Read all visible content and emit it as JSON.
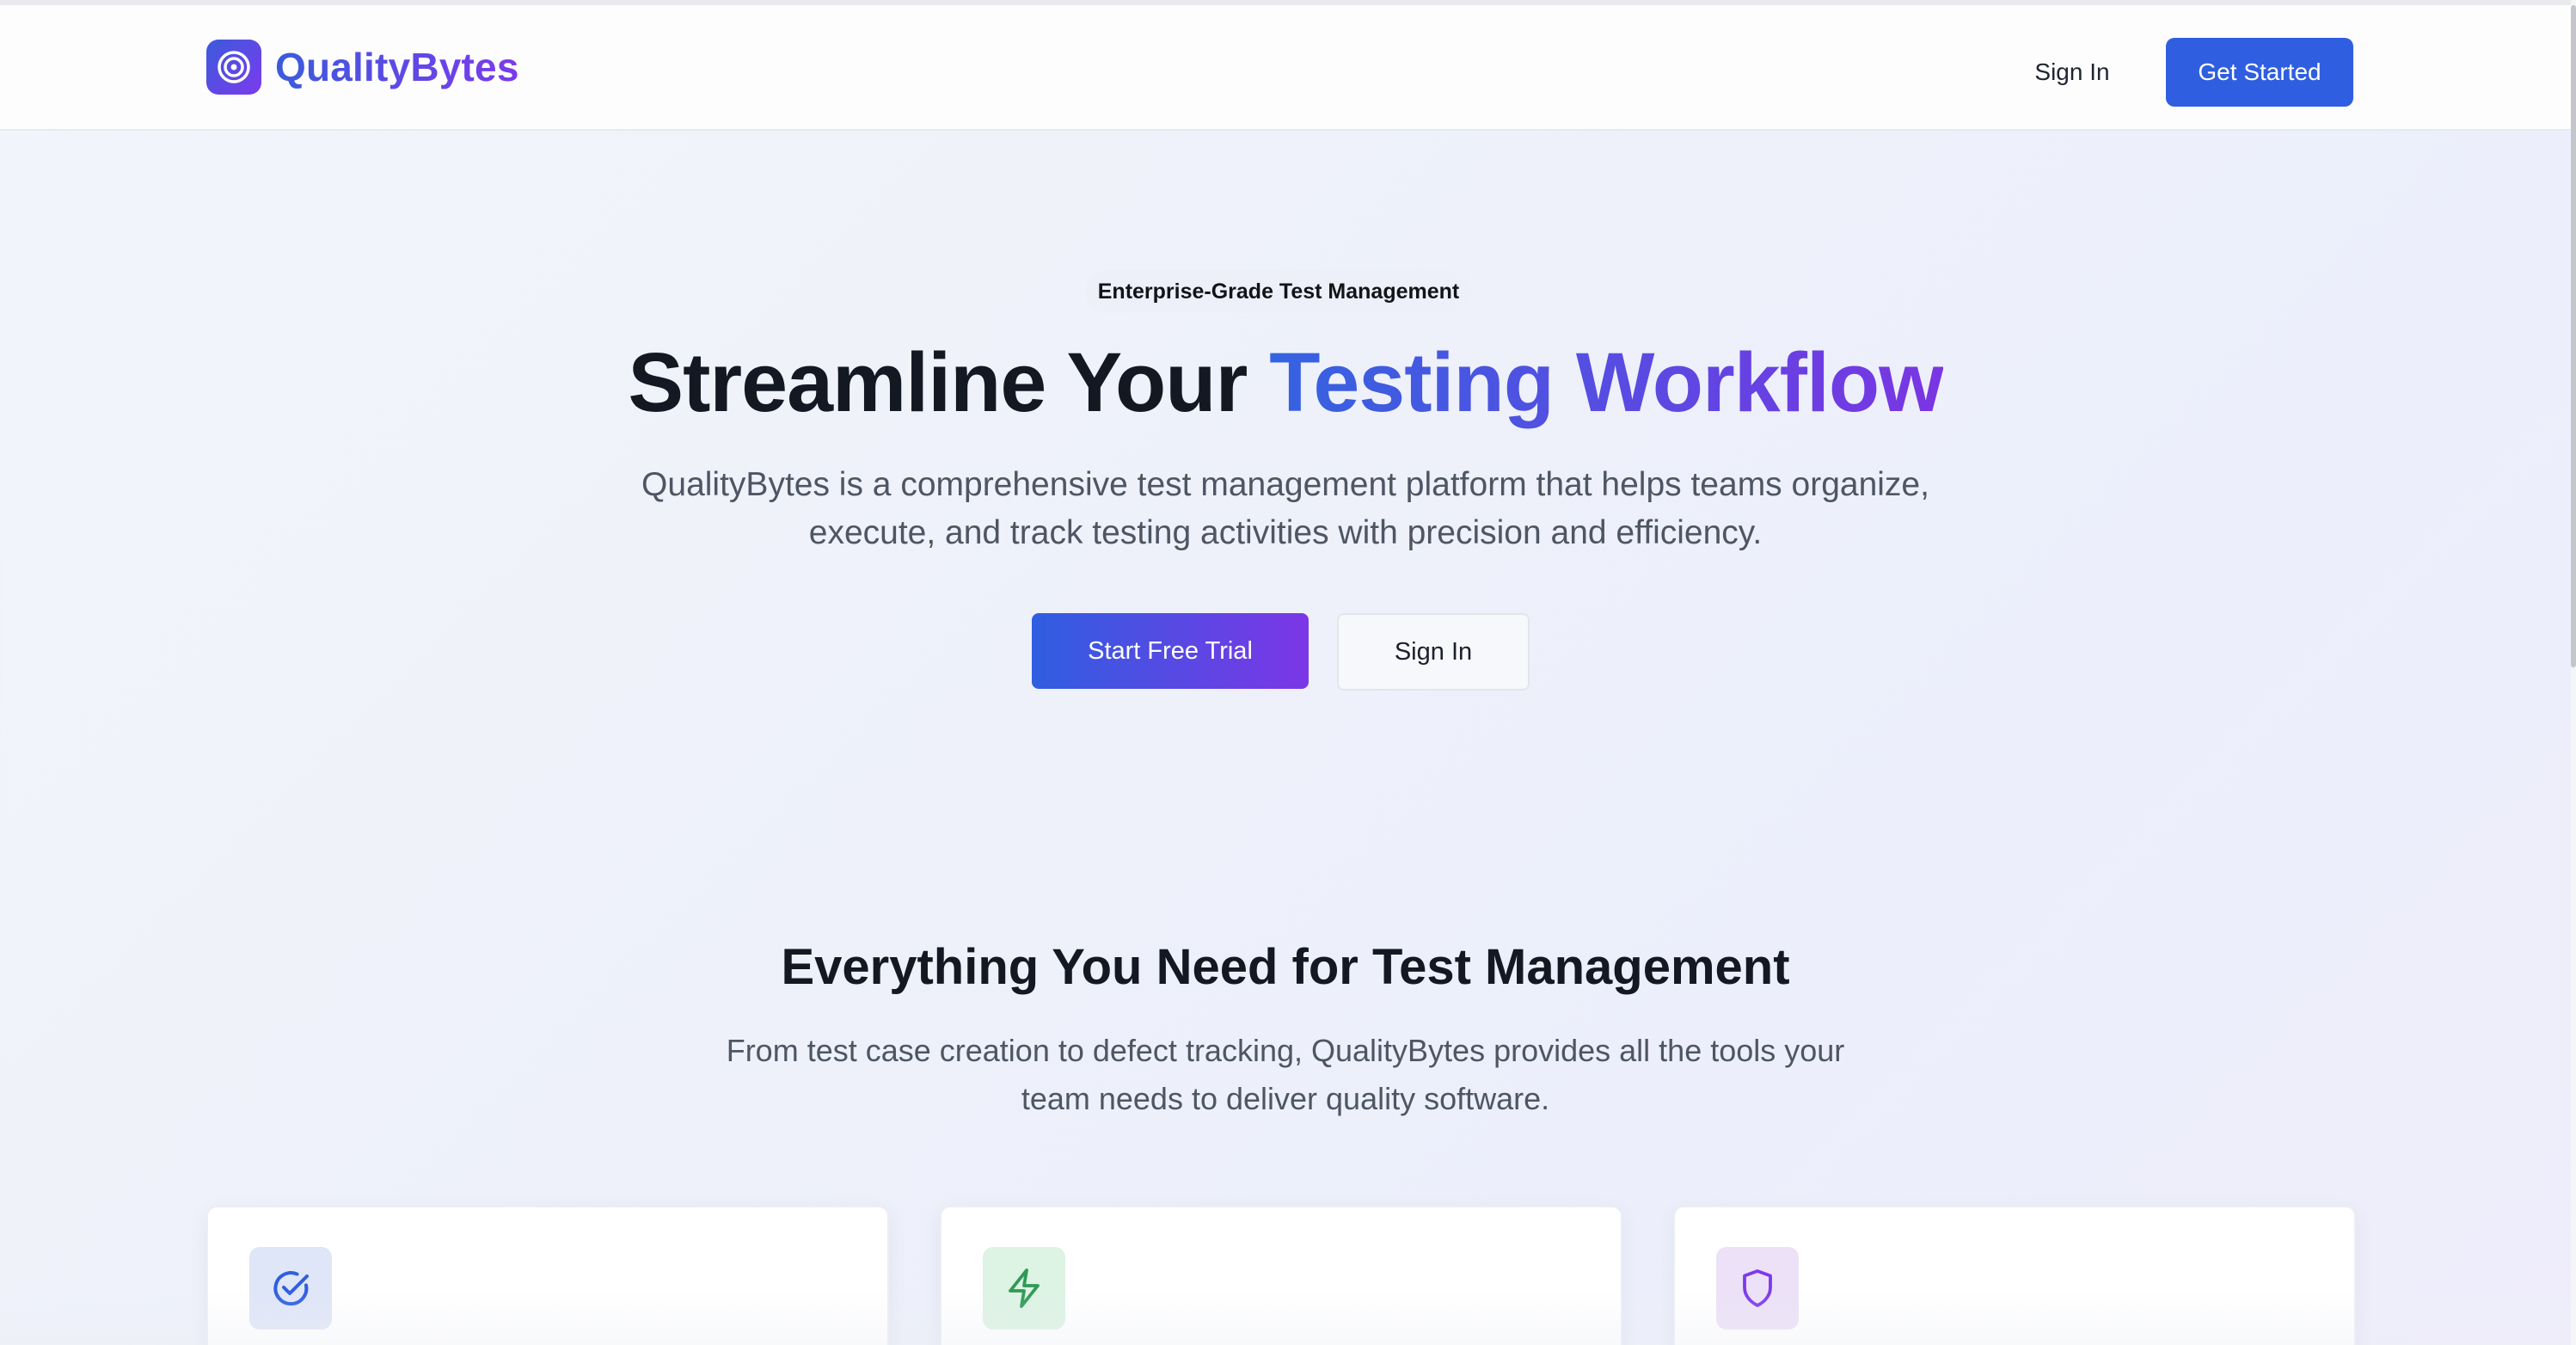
{
  "brand": {
    "name": "QualityBytes",
    "colors": {
      "primary": "#2f5ee0",
      "gradient_start": "#3463e0",
      "gradient_end": "#7a35e3"
    },
    "logo_icon": "target-icon"
  },
  "header": {
    "sign_in_label": "Sign In",
    "get_started_label": "Get Started"
  },
  "hero": {
    "badge": "Enterprise-Grade Test Management",
    "title_plain": "Streamline Your ",
    "title_highlight": "Testing Workflow",
    "subtitle_line1": "QualityBytes is a comprehensive test management platform that helps teams organize,",
    "subtitle_line2": "execute, and track testing activities with precision and efficiency.",
    "primary_cta": "Start Free Trial",
    "secondary_cta": "Sign In"
  },
  "features": {
    "title": "Everything You Need for Test Management",
    "subtitle_line1": "From test case creation to defect tracking, QualityBytes provides all the tools your",
    "subtitle_line2": "team needs to deliver quality software.",
    "cards": [
      {
        "icon": "check-circle-icon",
        "color": "#2f5ee0"
      },
      {
        "icon": "lightning-icon",
        "color": "#2f9a55"
      },
      {
        "icon": "shield-icon",
        "color": "#7c3aed"
      }
    ]
  }
}
